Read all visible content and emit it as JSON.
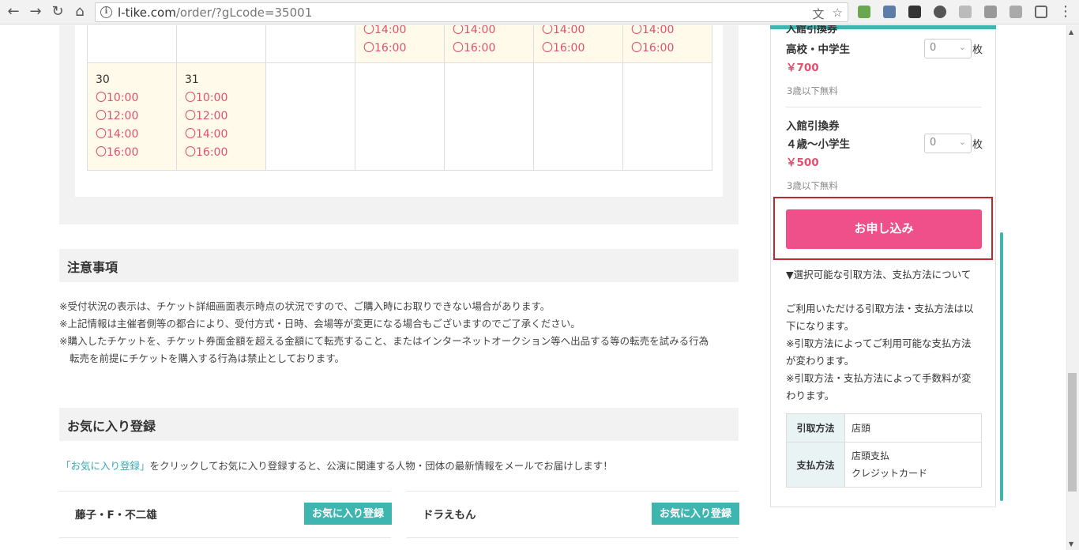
{
  "browser": {
    "url_host": "l-tike.com",
    "url_path": "/order/?gLcode=35001"
  },
  "calendar": {
    "row_top": {
      "cells": [
        {
          "slots": []
        },
        {
          "slots": []
        },
        {
          "slots": []
        },
        {
          "slots": [
            "〇14:00",
            "〇16:00"
          ]
        },
        {
          "slots": [
            "〇14:00",
            "〇16:00"
          ]
        },
        {
          "slots": [
            "〇14:00",
            "〇16:00"
          ]
        },
        {
          "slots": [
            "〇14:00",
            "〇16:00"
          ]
        }
      ]
    },
    "row_bottom": {
      "cells": [
        {
          "day": "30",
          "slots": [
            "〇10:00",
            "〇12:00",
            "〇14:00",
            "〇16:00"
          ]
        },
        {
          "day": "31",
          "slots": [
            "〇10:00",
            "〇12:00",
            "〇14:00",
            "〇16:00"
          ]
        }
      ]
    }
  },
  "notices": {
    "heading": "注意事項",
    "lines": [
      "※受付状況の表示は、チケット詳細画面表示時点の状況ですので、ご購入時にお取りできない場合があります。",
      "※上記情報は主催者側等の都合により、受付方式・日時、会場等が変更になる場合もございますのでご了承ください。",
      "※購入したチケットを、チケット券面金額を超える金額にて転売すること、またはインターネットオークション等へ出品する等の転売を試みる行為",
      "転売を前提にチケットを購入する行為は禁止としております。"
    ]
  },
  "favorites": {
    "heading": "お気に入り登録",
    "desc_link": "「お気に入り登録」",
    "desc_rest": "をクリックしてお気に入り登録すると、公演に関連する人物・団体の最新情報をメールでお届けします！",
    "items": [
      {
        "name": "藤子・F・不二雄",
        "button": "お気に入り登録"
      },
      {
        "name": "ドラえもん",
        "button": "お気に入り登録"
      }
    ]
  },
  "side": {
    "cut_title": "入館引換券",
    "tickets": [
      {
        "title": "高校・中学生",
        "price": "￥700",
        "qty": "0",
        "unit": "枚",
        "note": "3歳以下無料"
      },
      {
        "title_line1": "入館引換券",
        "title": "４歳～小学生",
        "price": "￥500",
        "qty": "0",
        "unit": "枚",
        "note": "3歳以下無料"
      }
    ],
    "apply_label": "お申し込み",
    "methods_heading": "▼選択可能な引取方法、支払方法について",
    "methods_desc": [
      "ご利用いただける引取方法・支払方法は以",
      "下になります。",
      "※引取方法によってご利用可能な支払方法",
      "が変わります。",
      "※引取方法・支払方法によって手数料が変",
      "わります。"
    ],
    "method_table": {
      "pickup_label": "引取方法",
      "pickup_value": "店頭",
      "payment_label": "支払方法",
      "payment_values": [
        "店頭支払",
        "クレジットカード"
      ]
    }
  }
}
